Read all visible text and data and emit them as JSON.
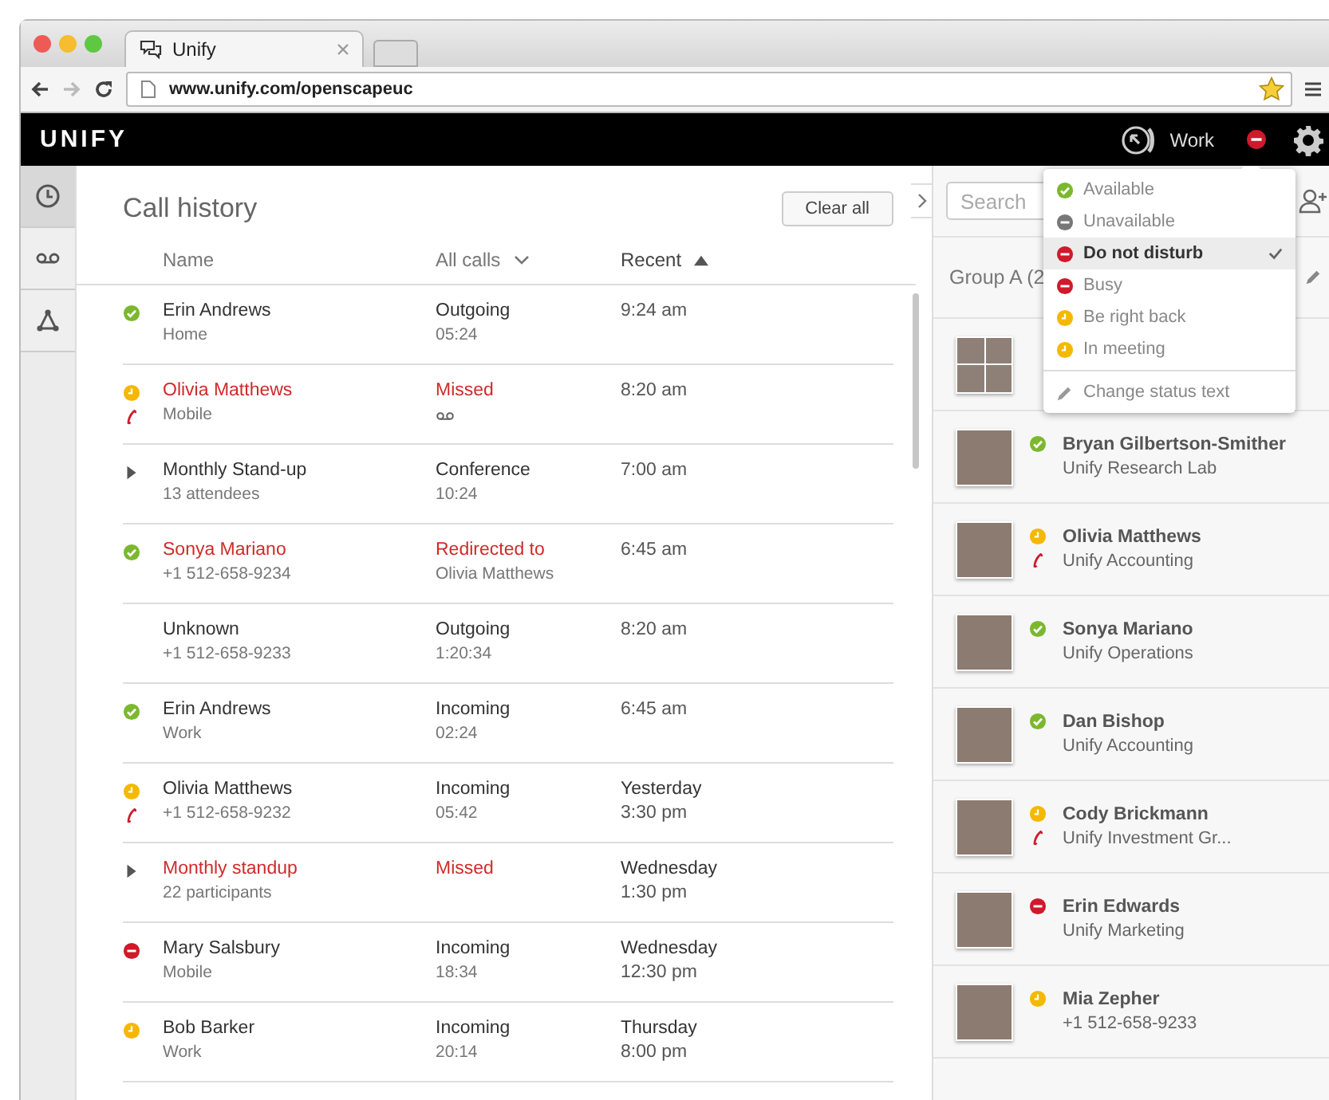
{
  "browser": {
    "tab_title": "Unify",
    "url": "www.unify.com/openscapeuc"
  },
  "header": {
    "logo": "UNIFY",
    "location": "Work",
    "status_icon": {
      "kind": "minus",
      "color": "#d0192b"
    }
  },
  "sidebar": {
    "items": [
      {
        "kind": "history",
        "selected": true
      },
      {
        "kind": "voicemail",
        "selected": false
      },
      {
        "kind": "network",
        "selected": false
      }
    ]
  },
  "call_history": {
    "title": "Call history",
    "clear_button": "Clear all",
    "columns": [
      {
        "label": "Name",
        "kind": "plain"
      },
      {
        "label": "All calls",
        "kind": "filter"
      },
      {
        "label": "Recent",
        "kind": "sort"
      }
    ],
    "rows": [
      {
        "kind": "contact",
        "status_icon": {
          "kind": "check",
          "color": "#7cb82f"
        },
        "name": "Erin Andrews",
        "detail": "Home",
        "missed": false,
        "phone": false,
        "type": "Outgoing",
        "duration": "05:24",
        "voicemail": false,
        "when": "9:24 am"
      },
      {
        "kind": "contact",
        "status_icon": {
          "kind": "clock",
          "color": "#f5b800"
        },
        "name": "Olivia Matthews",
        "detail": "Mobile",
        "missed": true,
        "phone": true,
        "type": "Missed",
        "voicemail": true,
        "when": "8:20 am"
      },
      {
        "kind": "conference",
        "name": "Monthly Stand-up",
        "detail": "13 attendees",
        "missed": false,
        "phone": false,
        "type": "Conference",
        "duration": "10:24",
        "voicemail": false,
        "when": "7:00 am"
      },
      {
        "kind": "contact",
        "status_icon": {
          "kind": "check",
          "color": "#7cb82f"
        },
        "name": "Sonya Mariano",
        "detail": "+1 512-658-9234",
        "missed": true,
        "phone": false,
        "type": "Redirected to",
        "duration": "Olivia Matthews",
        "voicemail": false,
        "when": "6:45 am"
      },
      {
        "kind": "unknown",
        "name": "Unknown",
        "detail": "+1 512-658-9233",
        "missed": false,
        "phone": false,
        "type": "Outgoing",
        "duration": "1:20:34",
        "voicemail": false,
        "when": "8:20 am"
      },
      {
        "kind": "contact",
        "status_icon": {
          "kind": "check",
          "color": "#7cb82f"
        },
        "name": "Erin Andrews",
        "detail": "Work",
        "missed": false,
        "phone": false,
        "type": "Incoming",
        "duration": "02:24",
        "voicemail": false,
        "when": "6:45 am"
      },
      {
        "kind": "contact",
        "status_icon": {
          "kind": "clock",
          "color": "#f5b800"
        },
        "name": "Olivia Matthews",
        "detail": "+1 512-658-9232",
        "missed": false,
        "phone": true,
        "type": "Incoming",
        "duration": "05:42",
        "voicemail": false,
        "when": "Yesterday",
        "time": "3:30 pm"
      },
      {
        "kind": "conference",
        "name": "Monthly standup",
        "detail": "22 participants",
        "missed": true,
        "phone": false,
        "type": "Missed",
        "voicemail": false,
        "when": "Wednesday",
        "time": "1:30 pm"
      },
      {
        "kind": "contact",
        "status_icon": {
          "kind": "minus",
          "color": "#d0192b"
        },
        "name": "Mary Salsbury",
        "detail": "Mobile",
        "missed": false,
        "phone": false,
        "type": "Incoming",
        "duration": "18:34",
        "voicemail": false,
        "when": "Wednesday",
        "time": "12:30 pm"
      },
      {
        "kind": "contact",
        "status_icon": {
          "kind": "clock",
          "color": "#f5b800"
        },
        "name": "Bob Barker",
        "detail": "Work",
        "missed": false,
        "phone": false,
        "type": "Incoming",
        "duration": "20:14",
        "voicemail": false,
        "when": "Thursday",
        "time": "8:00 pm"
      }
    ]
  },
  "contacts": {
    "search": {
      "placeholder": "Search"
    },
    "group_label": "Group A (2",
    "items": [
      {
        "kind": "group"
      },
      {
        "kind": "contact",
        "status_icon": {
          "kind": "check",
          "color": "#7cb82f"
        },
        "name": "Bryan Gilbertson-Smither",
        "detail": "Unify Research Lab",
        "phone": false
      },
      {
        "kind": "contact",
        "status_icon": {
          "kind": "clock",
          "color": "#f5b800"
        },
        "name": "Olivia Matthews",
        "detail": "Unify Accounting",
        "phone": true
      },
      {
        "kind": "contact",
        "status_icon": {
          "kind": "check",
          "color": "#7cb82f"
        },
        "name": "Sonya Mariano",
        "detail": "Unify Operations",
        "phone": false
      },
      {
        "kind": "contact",
        "status_icon": {
          "kind": "check",
          "color": "#7cb82f"
        },
        "name": "Dan Bishop",
        "detail": "Unify Accounting",
        "phone": false
      },
      {
        "kind": "contact",
        "status_icon": {
          "kind": "clock",
          "color": "#f5b800"
        },
        "name": "Cody Brickmann",
        "detail": "Unify Investment Gr...",
        "phone": true
      },
      {
        "kind": "contact",
        "status_icon": {
          "kind": "minus",
          "color": "#d0192b"
        },
        "name": "Erin Edwards",
        "detail": "Unify Marketing",
        "phone": false
      },
      {
        "kind": "contact",
        "status_icon": {
          "kind": "clock",
          "color": "#f5b800"
        },
        "name": "Mia Zepher",
        "detail": "+1 512-658-9233",
        "phone": false
      }
    ]
  },
  "status_menu": {
    "items": [
      {
        "kind": "status",
        "status_icon": {
          "kind": "check",
          "color": "#7cb82f"
        },
        "label": "Available",
        "selected": false
      },
      {
        "kind": "status",
        "status_icon": {
          "kind": "minus",
          "color": "#777777"
        },
        "label": "Unavailable",
        "selected": false
      },
      {
        "kind": "status",
        "status_icon": {
          "kind": "minus",
          "color": "#d0192b"
        },
        "label": "Do not disturb",
        "selected": true
      },
      {
        "kind": "status",
        "status_icon": {
          "kind": "minus",
          "color": "#d0192b"
        },
        "label": "Busy",
        "selected": false
      },
      {
        "kind": "status",
        "status_icon": {
          "kind": "clock",
          "color": "#f5b800"
        },
        "label": "Be right back",
        "selected": false
      },
      {
        "kind": "status",
        "status_icon": {
          "kind": "clock",
          "color": "#f5b800"
        },
        "label": "In meeting",
        "selected": false
      },
      {
        "kind": "edit",
        "label": "Change status text",
        "selected": false
      }
    ]
  }
}
